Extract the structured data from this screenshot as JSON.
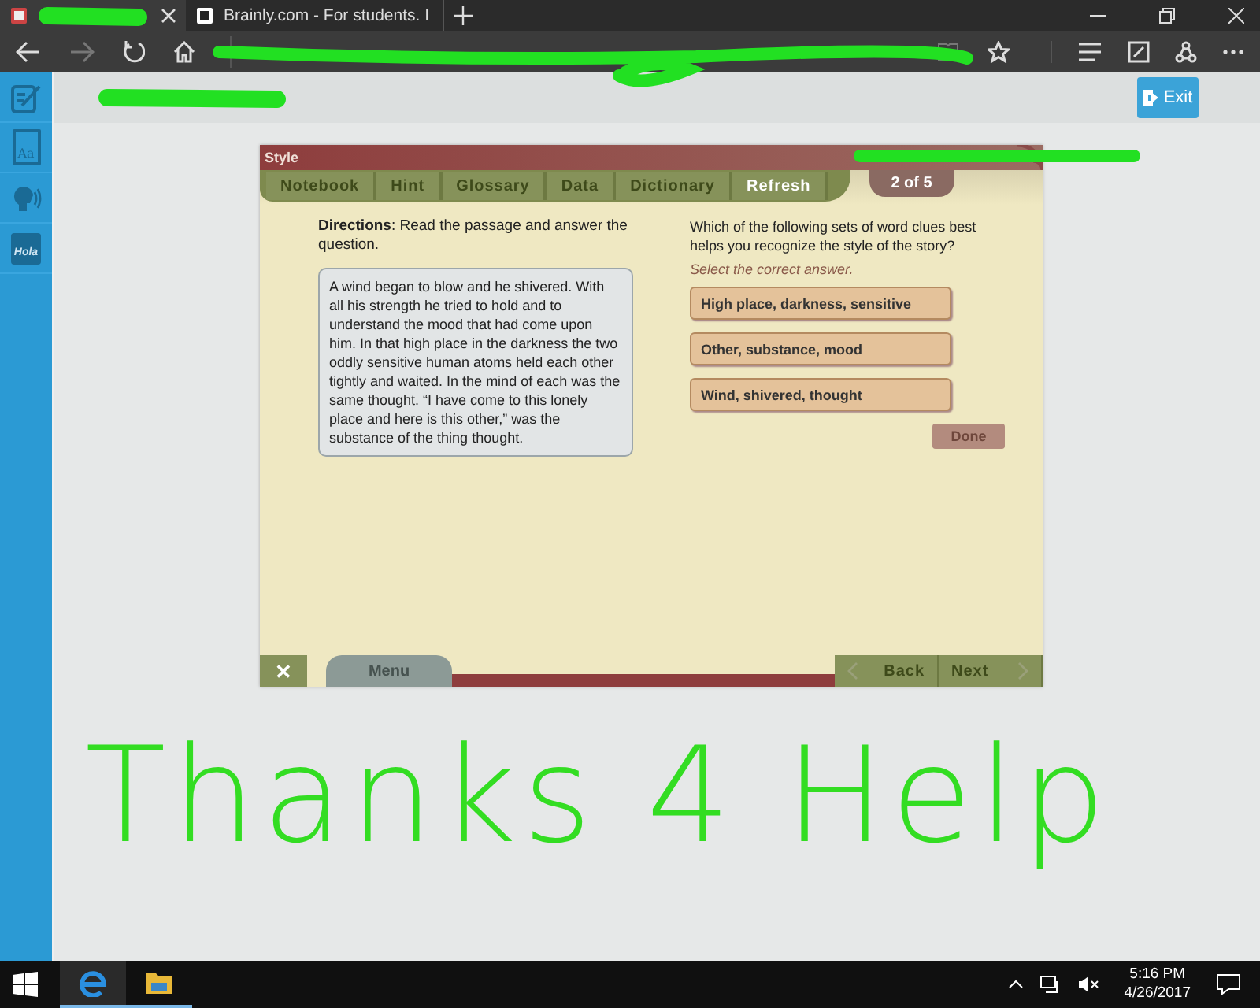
{
  "browser": {
    "tabs": [
      {
        "selected": true
      },
      {
        "title": "Brainly.com - For students. I",
        "selected": false
      }
    ]
  },
  "sidebar": {
    "items": [
      {
        "kind": "notebook"
      },
      {
        "kind": "dictionary",
        "label": "Aa"
      },
      {
        "kind": "speech"
      },
      {
        "kind": "translate",
        "label": "Hola"
      }
    ]
  },
  "header": {
    "exit_button": "Exit"
  },
  "activity": {
    "title": "Style",
    "tabs": [
      {
        "label": "Notebook",
        "disabled": true
      },
      {
        "label": "Hint",
        "disabled": true
      },
      {
        "label": "Glossary",
        "disabled": true
      },
      {
        "label": "Data",
        "disabled": true
      },
      {
        "label": "Dictionary",
        "disabled": true
      },
      {
        "label": "Refresh",
        "disabled": false
      }
    ],
    "progress": "2 of 5",
    "directions": "**Directions**: Read the passage and answer the question.",
    "passage": "A wind began to blow and he shivered. With all his strength he tried to hold and to understand the mood that had come upon him. In that high place in the darkness the two oddly sensitive human atoms held each other tightly and waited. In the mind of each was the same thought. “I have come to this lonely place and here is this other,” was the substance of the thing thought.",
    "question": "Which of the following sets of word clues best helps you recognize the style of the story?",
    "instruction": "Select the correct answer.",
    "answers": [
      {
        "label": "High place, darkness, sensitive",
        "selected": false
      },
      {
        "label": "Other, substance, mood",
        "selected": false
      },
      {
        "label": "Wind, shivered, thought",
        "selected": false
      }
    ],
    "done_button": {
      "label": "Done",
      "disabled": true
    },
    "footer": {
      "close": "✕",
      "menu": {
        "label": "Menu",
        "disabled": true
      },
      "back": {
        "label": "Back",
        "disabled": true
      },
      "next": {
        "label": "Next",
        "disabled": true
      }
    }
  },
  "annotation": "Thanks 4 Help",
  "taskbar": {
    "time": "5:16 PM",
    "date": "4/26/2017"
  }
}
